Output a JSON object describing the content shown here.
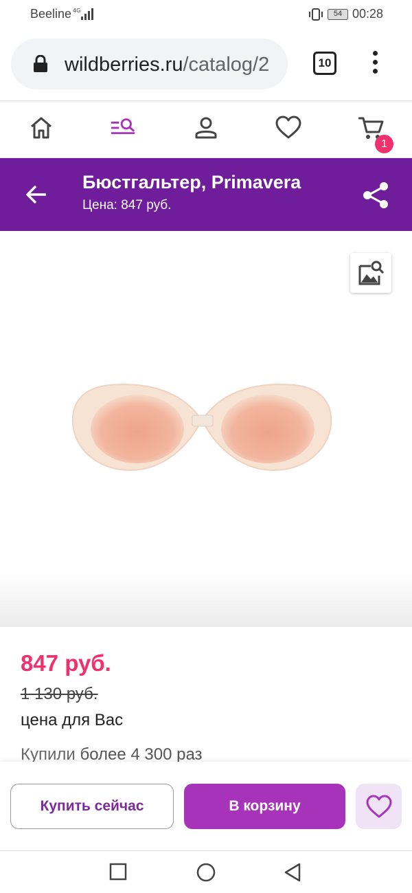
{
  "status_bar": {
    "carrier": "Beeline",
    "network": "4G",
    "battery": "54",
    "time": "00:28"
  },
  "browser": {
    "url_host": "wildberries.ru",
    "url_path": "/catalog/2",
    "tab_count": "10"
  },
  "top_nav": {
    "items": [
      "home-icon",
      "catalog-search-icon",
      "profile-icon",
      "favorites-icon",
      "cart-icon"
    ],
    "cart_badge": "1"
  },
  "header": {
    "title": "Бюстгальтер, Primavera",
    "subtitle": "Цена: 847 руб."
  },
  "product": {
    "price": "847 руб.",
    "old_price": "1 130 руб.",
    "price_note": "цена для Вас",
    "bought_prefix": "Купили",
    "bought_count": "более 4 300 раз"
  },
  "actions": {
    "buy_now": "Купить сейчас",
    "add_to_cart": "В корзину"
  },
  "colors": {
    "brand_purple": "#6f1d9b",
    "button_purple": "#a733bb",
    "price_pink": "#f0316d"
  }
}
